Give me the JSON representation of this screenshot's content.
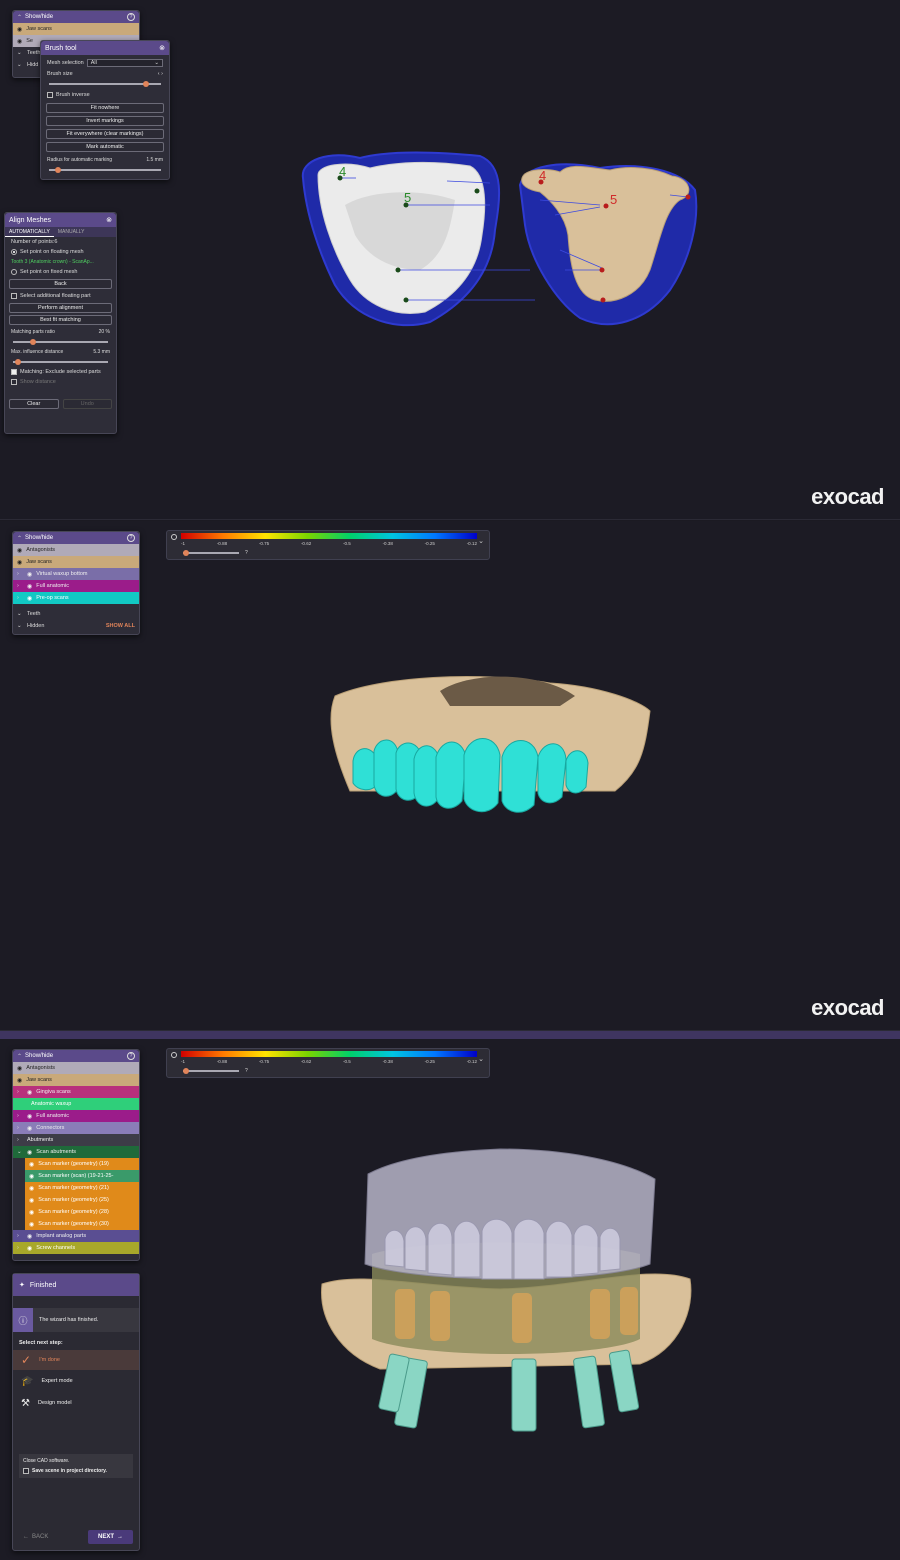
{
  "brand": "exocad",
  "s1": {
    "showhide": {
      "title": "Show/hide",
      "items": [
        "Jaw scans",
        "Se",
        "Teeth",
        "Hidd"
      ]
    },
    "brush": {
      "title": "Brush tool",
      "mesh_label": "Mesh selection",
      "mesh_value": "All",
      "size_label": "Brush size",
      "inverse_label": "Brush inverse",
      "buttons": [
        "Fit nowhere",
        "Invert markings",
        "Fit everywhere (clear markings)",
        "Mark automatic"
      ],
      "radius_label": "Radius for automatic marking",
      "radius_value": "1.5 mm"
    },
    "align": {
      "title": "Align Meshes",
      "tab_auto": "AUTOMATICALLY",
      "tab_manual": "MANUALLY",
      "num_points": "Number of points:6",
      "radio1": "Set point on floating mesh",
      "tooth_info": "Tooth 3 (Anatomic crown) - ScanAp...",
      "radio2": "Set point on fixed mesh",
      "back": "Back",
      "select_floating": "Select additional floating part",
      "perform": "Perform alignment",
      "bestfit": "Best fit matching",
      "ratio_label": "Matching parts ratio",
      "ratio_value": "20 %",
      "influence_label": "Max. influence distance",
      "influence_value": "5.3 mm",
      "exclude_label": "Matching: Exclude selected parts",
      "show_distance": "Show distance",
      "clear": "Clear",
      "undo": "Undo"
    },
    "markers_left": [
      "4",
      "5"
    ],
    "markers_right": [
      "4",
      "5"
    ]
  },
  "scale": {
    "ticks": [
      "-1",
      "-0.88",
      "-0.75",
      "-0.62",
      "-0.5",
      "-0.38",
      "-0.25",
      "-0.12"
    ],
    "q": "?"
  },
  "s2": {
    "showhide": {
      "title": "Show/hide",
      "items": [
        {
          "label": "Antagonists",
          "color": "#b0aab8"
        },
        {
          "label": "Jaw scans",
          "color": "#c9a97a"
        },
        {
          "label": "Virtual waxup bottom",
          "color": "#7a6ea8"
        },
        {
          "label": "Full anatomic",
          "color": "#9b1c8a"
        },
        {
          "label": "Pre-op scans",
          "color": "#12c9c4"
        }
      ],
      "teeth": "Teeth",
      "hidden": "Hidden",
      "show_all": "SHOW ALL"
    }
  },
  "s3": {
    "showhide": {
      "title": "Show/hide",
      "items": [
        {
          "label": "Antagonists",
          "color": "#b0aab8"
        },
        {
          "label": "Jaw scans",
          "color": "#c9a97a"
        },
        {
          "label": "Gingiva scans",
          "color": "#b8307c"
        },
        {
          "label": "Anatomic waxup",
          "color": "#2fcf7a"
        },
        {
          "label": "Full anatomic",
          "color": "#9b1c8a"
        },
        {
          "label": "Connectors",
          "color": "#8a7db8"
        },
        {
          "label": "Abutments",
          "color": "#3d3c47"
        },
        {
          "label": "Scan abutments",
          "color": "#1f6a3a"
        },
        {
          "label": "Scan marker (geometry) (19)",
          "color": "#e08a1a"
        },
        {
          "label": "Scan marker (scan) (19-21-25-",
          "color": "#3a9a6a"
        },
        {
          "label": "Scan marker (geometry) (21)",
          "color": "#e08a1a"
        },
        {
          "label": "Scan marker (geometry) (25)",
          "color": "#e08a1a"
        },
        {
          "label": "Scan marker (geometry) (28)",
          "color": "#e08a1a"
        },
        {
          "label": "Scan marker (geometry) (30)",
          "color": "#e08a1a"
        },
        {
          "label": "Implant analog parts",
          "color": "#5a4e92"
        },
        {
          "label": "Screw channels",
          "color": "#a8a82a"
        }
      ]
    },
    "wizard": {
      "title": "Finished",
      "info": "The wizard has finished.",
      "next_step": "Select next step:",
      "options": [
        "I'm done",
        "Expert mode",
        "Design model"
      ],
      "close_label": "Close CAD software.",
      "save_label": "Save scene in project directory.",
      "back": "BACK",
      "next": "NEXT"
    }
  }
}
